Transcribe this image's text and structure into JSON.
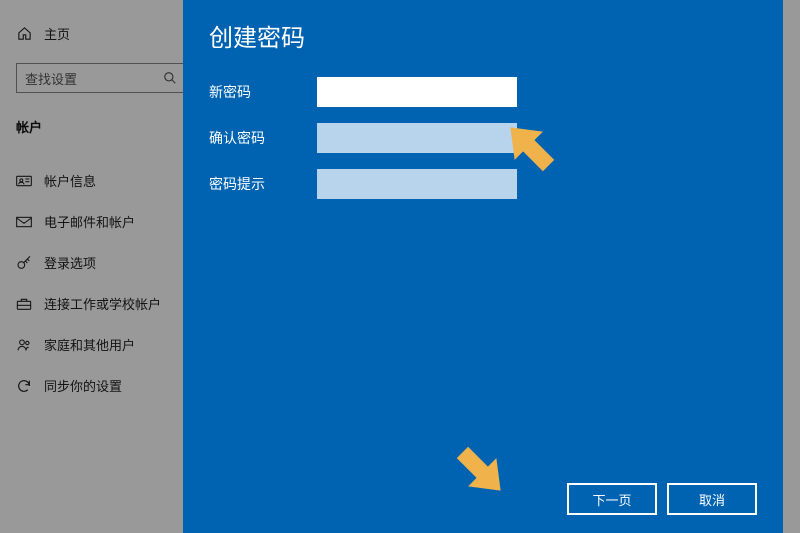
{
  "sidebar": {
    "home": "主页",
    "searchPlaceholder": "查找设置",
    "section": "帐户",
    "items": [
      {
        "label": "帐户信息"
      },
      {
        "label": "电子邮件和帐户"
      },
      {
        "label": "登录选项"
      },
      {
        "label": "连接工作或学校帐户"
      },
      {
        "label": "家庭和其他用户"
      },
      {
        "label": "同步你的设置"
      }
    ]
  },
  "dialog": {
    "title": "创建密码",
    "fields": {
      "newPassword": "新密码",
      "confirmPassword": "确认密码",
      "hint": "密码提示"
    },
    "buttons": {
      "next": "下一页",
      "cancel": "取消"
    }
  },
  "colors": {
    "dialogBg": "#0063B1",
    "arrow": "#F0B24B"
  }
}
